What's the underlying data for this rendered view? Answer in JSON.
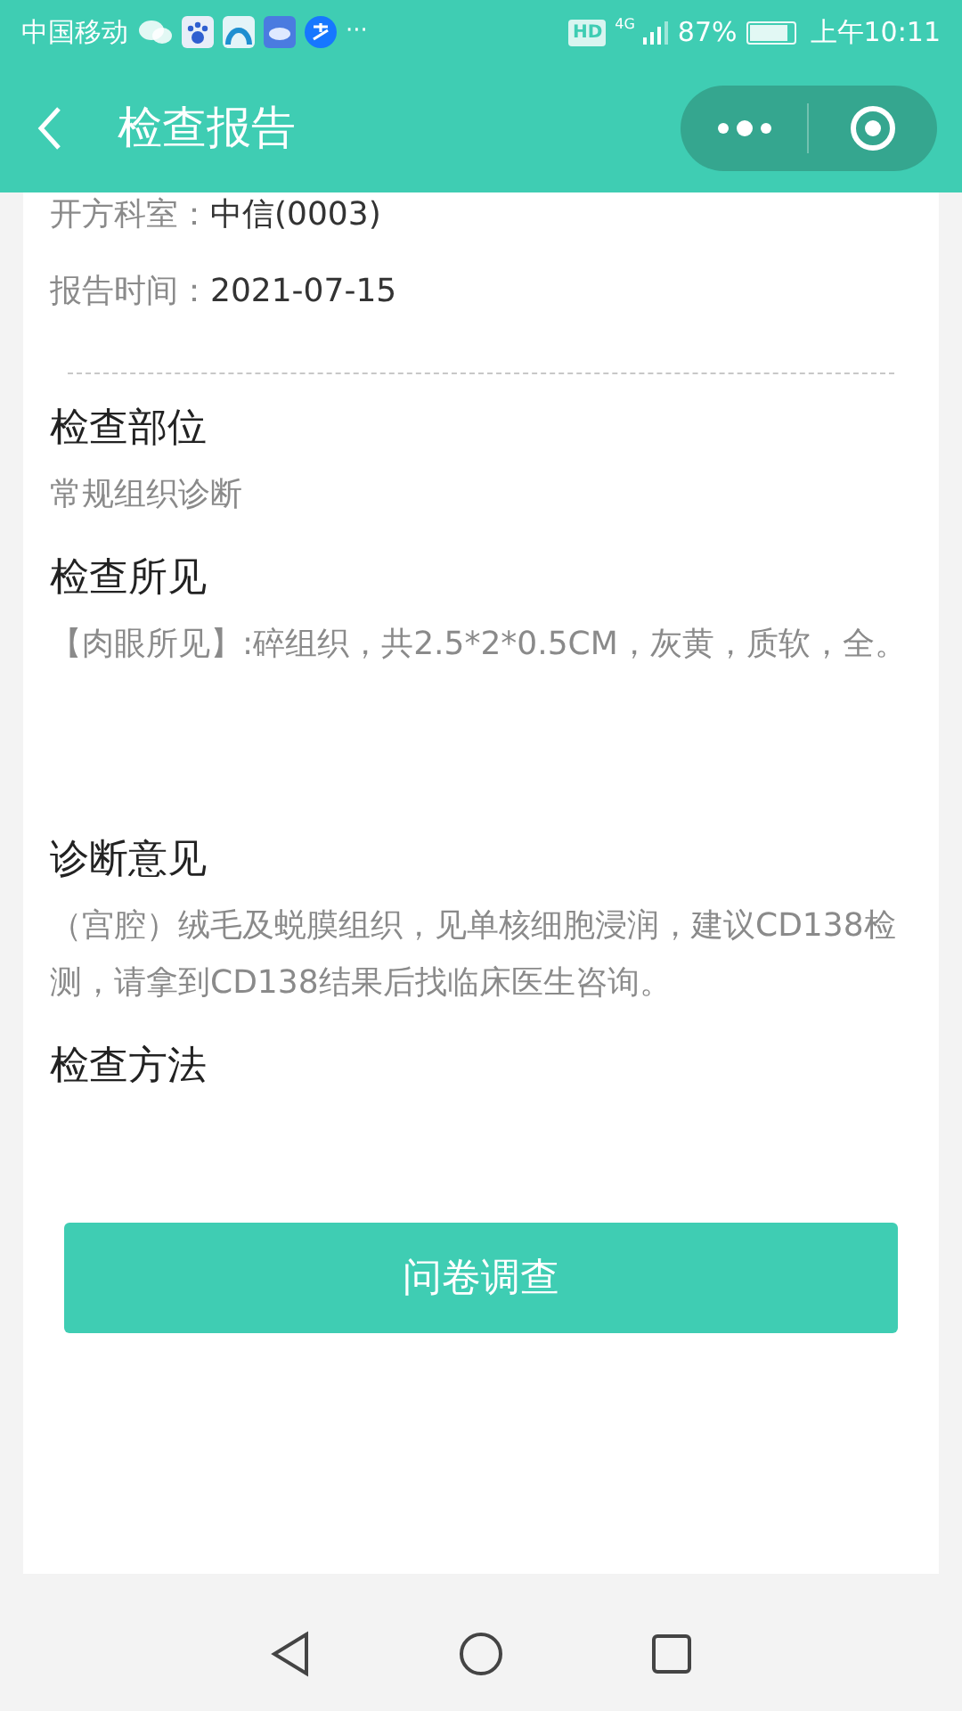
{
  "status_bar": {
    "carrier": "中国移动",
    "more": "···",
    "hd": "HD",
    "network": "4G",
    "battery": "87%",
    "time": "上午10:11"
  },
  "header": {
    "title": "检查报告"
  },
  "info_rows": [
    {
      "label": "开方科室：",
      "value": "中信(0003)"
    },
    {
      "label": "报告时间：",
      "value": "2021-07-15"
    }
  ],
  "sections": [
    {
      "title": "检查部位",
      "body": "常规组织诊断"
    },
    {
      "title": "检查所见",
      "body": "【肉眼所见】:碎组织，共2.5*2*0.5CM，灰黄，质软，全。"
    },
    {
      "title": "诊断意见",
      "body": "（宫腔）绒毛及蜕膜组织，见单核细胞浸润，建议CD138检测，请拿到CD138结果后找临床医生咨询。"
    },
    {
      "title": "检查方法"
    }
  ],
  "survey_button": "问卷调查"
}
